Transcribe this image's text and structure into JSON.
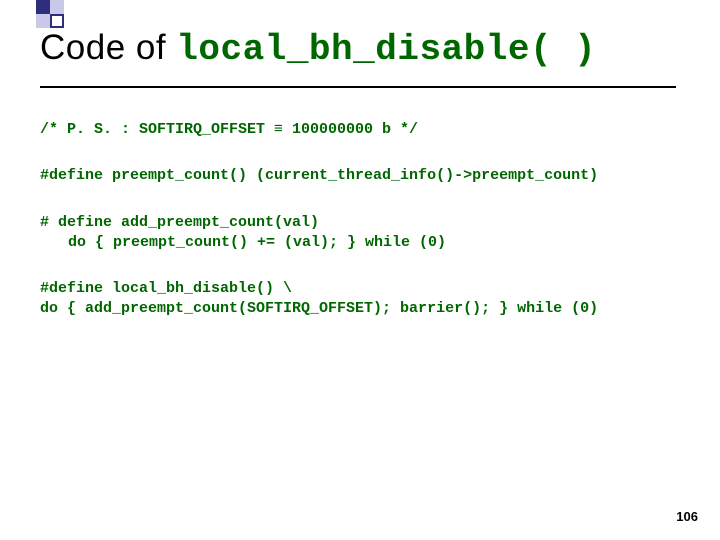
{
  "title": {
    "prefix": "Code of ",
    "code": "local_bh_disable( )"
  },
  "code": {
    "line1": "/* P. S. : SOFTIRQ_OFFSET ≡ 100000000 b */",
    "line2": "#define preempt_count() (current_thread_info()->preempt_count)",
    "line3a": "# define add_preempt_count(val)",
    "line3b": "do { preempt_count() += (val); } while (0)",
    "line4a": "#define local_bh_disable() \\",
    "line4b": "do { add_preempt_count(SOFTIRQ_OFFSET); barrier(); } while (0)"
  },
  "page_number": "106"
}
